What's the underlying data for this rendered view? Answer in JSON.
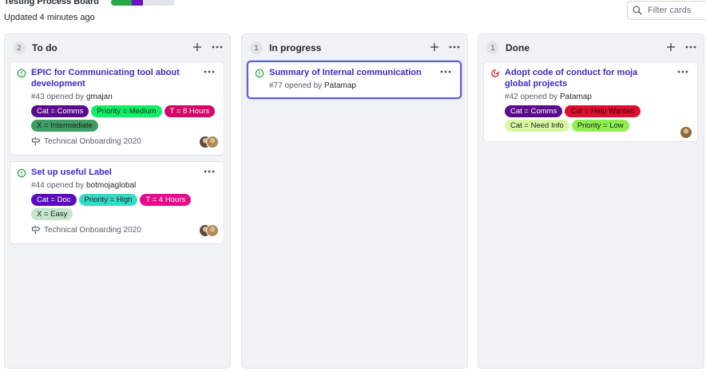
{
  "header": {
    "title": "Testing Process Board",
    "updated": "Updated 4 minutes ago",
    "progress": {
      "done": 0.33,
      "in_progress": 0.17,
      "colors": {
        "done": "#28a745",
        "in_progress": "#6f12c6",
        "todo": "#e1e4e8"
      }
    },
    "filter_placeholder": "Filter cards"
  },
  "columns": [
    {
      "name": "To do",
      "count": "2",
      "cards": [
        {
          "title": "EPIC for Communicating tool about development",
          "status": "open",
          "number": "#43",
          "opened_by": "opened by",
          "author": "gmajan",
          "labels": [
            {
              "text": "Cat = Comms",
              "bg": "#5b0b8c",
              "fg": "#ffffff"
            },
            {
              "text": "Priority = Medium",
              "bg": "#0cf064",
              "fg": "#1b1f23"
            },
            {
              "text": "T = 8 Hours",
              "bg": "#d6056a",
              "fg": "#ffffff"
            },
            {
              "text": "X = Intermediate",
              "bg": "#3f9e64",
              "fg": "#1b1f23"
            }
          ],
          "milestone": "Technical Onboarding 2020",
          "avatars": 2
        },
        {
          "title": "Set up useful Label",
          "status": "open",
          "number": "#44",
          "opened_by": "opened by",
          "author": "botmojaglobal",
          "labels": [
            {
              "text": "Cat = Doc",
              "bg": "#5b0bbd",
              "fg": "#ffffff"
            },
            {
              "text": "Priority = High",
              "bg": "#34dcc8",
              "fg": "#1b1f23"
            },
            {
              "text": "T = 4 Hours",
              "bg": "#e60b8c",
              "fg": "#ffffff"
            },
            {
              "text": "X = Easy",
              "bg": "#c2e5cc",
              "fg": "#1b1f23"
            }
          ],
          "milestone": "Technical Onboarding 2020",
          "avatars": 2
        }
      ]
    },
    {
      "name": "In progress",
      "count": "1",
      "cards": [
        {
          "title": "Summary of Internal communication",
          "status": "open",
          "number": "#77",
          "opened_by": "opened by",
          "author": "Patamap",
          "labels": [],
          "milestone": "",
          "avatars": 0,
          "selected": true
        }
      ]
    },
    {
      "name": "Done",
      "count": "1",
      "cards": [
        {
          "title": "Adopt code of conduct for moja global projects",
          "status": "closed",
          "number": "#42",
          "opened_by": "opened by",
          "author": "Patamap",
          "labels": [
            {
              "text": "Cat = Comms",
              "bg": "#5b0b8c",
              "fg": "#ffffff"
            },
            {
              "text": "Cat = Help Wanted",
              "bg": "#e00f2f",
              "fg": "#3a0008"
            },
            {
              "text": "Cat = Need Info",
              "bg": "#d8f7a0",
              "fg": "#1b1f23"
            },
            {
              "text": "Priority = Low",
              "bg": "#8fee4e",
              "fg": "#1b1f23"
            }
          ],
          "milestone": "",
          "avatars": 1
        }
      ]
    }
  ],
  "icons": {
    "search": "search-icon",
    "add": "plus-icon",
    "menu": "kebab-menu-icon",
    "open_issue": "issue-opened-icon",
    "closed_issue": "issue-closed-icon",
    "milestone": "milestone-icon"
  }
}
